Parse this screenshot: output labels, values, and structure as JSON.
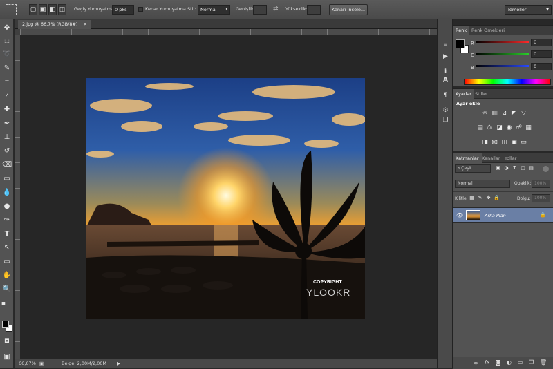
{
  "options_bar": {
    "feather_label": "Geçiş Yumuşatma:",
    "feather_value": "0 pks",
    "antialias_label": "Kenar Yumuşatma",
    "style_label": "Stil:",
    "style_value": "Normal",
    "width_label": "Genişlik:",
    "height_label": "Yükseklik:",
    "refine_edge_button": "Kenarı İncele...",
    "workspace_value": "Temeller"
  },
  "document": {
    "tab_title": "2.jpg @ 66,7% (RGB/8#)",
    "close_glyph": "×",
    "watermark_line1": "COPYRIGHT",
    "watermark_line2": "YLOOKR"
  },
  "status_bar": {
    "zoom": "66,67%",
    "doc_info": "Belge: 2,00M/2,00M"
  },
  "color_panel": {
    "tabs": [
      "Renk",
      "Renk Örnekleri"
    ],
    "channels": [
      {
        "label": "R",
        "value": "0",
        "color": "#ff2a2a"
      },
      {
        "label": "G",
        "value": "0",
        "color": "#2ad02a"
      },
      {
        "label": "B",
        "value": "0",
        "color": "#2a4aff"
      }
    ]
  },
  "adjustments_panel": {
    "tabs": [
      "Ayarlar",
      "Stiller"
    ],
    "heading": "Ayar ekle"
  },
  "layers_panel": {
    "tabs": [
      "Katmanlar",
      "Kanallar",
      "Yollar"
    ],
    "filter_label": "Çeşit",
    "blend_mode": "Normal",
    "opacity_label": "Opaklık:",
    "opacity_value": "100%",
    "lock_label": "Kilitle:",
    "fill_label": "Dolgu:",
    "fill_value": "100%",
    "layers": [
      {
        "name": "Arka Plan"
      }
    ]
  },
  "colors": {
    "accent": "#4a6fa5",
    "panel": "#535353",
    "canvas_bg": "#262626"
  }
}
